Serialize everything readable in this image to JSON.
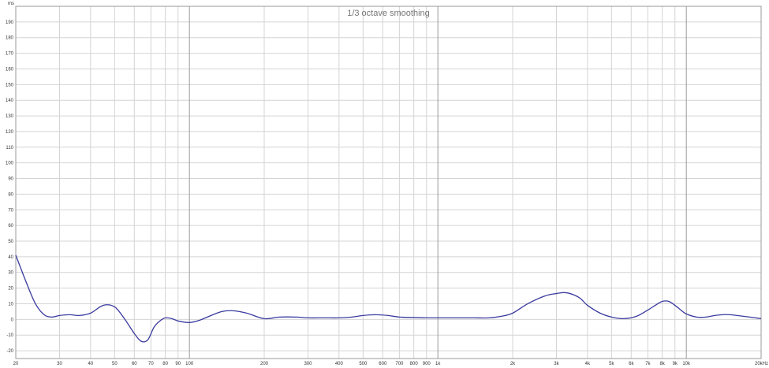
{
  "chart_data": {
    "type": "line",
    "title": "1/3 octave smoothing",
    "ylabel": "ms",
    "xlabel": "Hz",
    "x_scale": "log",
    "xlim": [
      20,
      20000
    ],
    "ylim": [
      -25,
      200
    ],
    "y_ticks": [
      -20,
      -10,
      0,
      10,
      20,
      30,
      40,
      50,
      60,
      70,
      80,
      90,
      100,
      110,
      120,
      130,
      140,
      150,
      160,
      170,
      180,
      190
    ],
    "x_ticks": [
      {
        "value": 20,
        "label": "20"
      },
      {
        "value": 30,
        "label": "30"
      },
      {
        "value": 40,
        "label": "40"
      },
      {
        "value": 50,
        "label": "50"
      },
      {
        "value": 60,
        "label": "60"
      },
      {
        "value": 70,
        "label": "70"
      },
      {
        "value": 80,
        "label": "80"
      },
      {
        "value": 90,
        "label": "90"
      },
      {
        "value": 100,
        "label": "100"
      },
      {
        "value": 200,
        "label": "200"
      },
      {
        "value": 300,
        "label": "300"
      },
      {
        "value": 400,
        "label": "400"
      },
      {
        "value": 500,
        "label": "500"
      },
      {
        "value": 600,
        "label": "600"
      },
      {
        "value": 700,
        "label": "700"
      },
      {
        "value": 800,
        "label": "800"
      },
      {
        "value": 900,
        "label": "900"
      },
      {
        "value": 1000,
        "label": "1k"
      },
      {
        "value": 2000,
        "label": "2k"
      },
      {
        "value": 3000,
        "label": "3k"
      },
      {
        "value": 4000,
        "label": "4k"
      },
      {
        "value": 5000,
        "label": "5k"
      },
      {
        "value": 6000,
        "label": "6k"
      },
      {
        "value": 7000,
        "label": "7k"
      },
      {
        "value": 8000,
        "label": "8k"
      },
      {
        "value": 9000,
        "label": "9k"
      },
      {
        "value": 10000,
        "label": "10k"
      },
      {
        "value": 20000,
        "label": "20k"
      }
    ],
    "grid": true,
    "major_x_gridlines": [
      100,
      1000,
      10000
    ],
    "line_color": "#3a3aa0",
    "grid_color": "#d4d4d4",
    "major_grid_color": "#9a9a9a",
    "series": [
      {
        "x": [
          20,
          22,
          24,
          26,
          28,
          30,
          33,
          36,
          40,
          45,
          50,
          55,
          60,
          64,
          68,
          72,
          76,
          80,
          85,
          90,
          100,
          110,
          120,
          135,
          150,
          170,
          200,
          230,
          270,
          300,
          350,
          400,
          450,
          500,
          560,
          630,
          700,
          800,
          900,
          1000,
          1200,
          1400,
          1600,
          1800,
          2000,
          2300,
          2700,
          3000,
          3300,
          3700,
          4000,
          4500,
          5000,
          5600,
          6300,
          7000,
          7500,
          8000,
          8500,
          9000,
          9500,
          10000,
          11000,
          12000,
          13000,
          14000,
          15000,
          16000,
          17000,
          18000,
          19000,
          20000
        ],
        "y": [
          41,
          24,
          10,
          3,
          1.5,
          2.5,
          3,
          2.5,
          4,
          9,
          8,
          0,
          -9,
          -14,
          -13,
          -5,
          -1,
          1,
          0.5,
          -1,
          -2,
          -0.5,
          2,
          5,
          5.5,
          4,
          0.5,
          1.5,
          1.5,
          1,
          1,
          1,
          1.5,
          2.5,
          3,
          2.5,
          1.5,
          1.2,
          1,
          1,
          1,
          1,
          1,
          2,
          4,
          10,
          15,
          16.5,
          17,
          14,
          9,
          4,
          1.5,
          0.5,
          2,
          6,
          9,
          11.5,
          11.5,
          9,
          6,
          3.5,
          1.5,
          1.5,
          2.5,
          3,
          3,
          2.5,
          2,
          1.5,
          1,
          0.5
        ]
      }
    ]
  }
}
